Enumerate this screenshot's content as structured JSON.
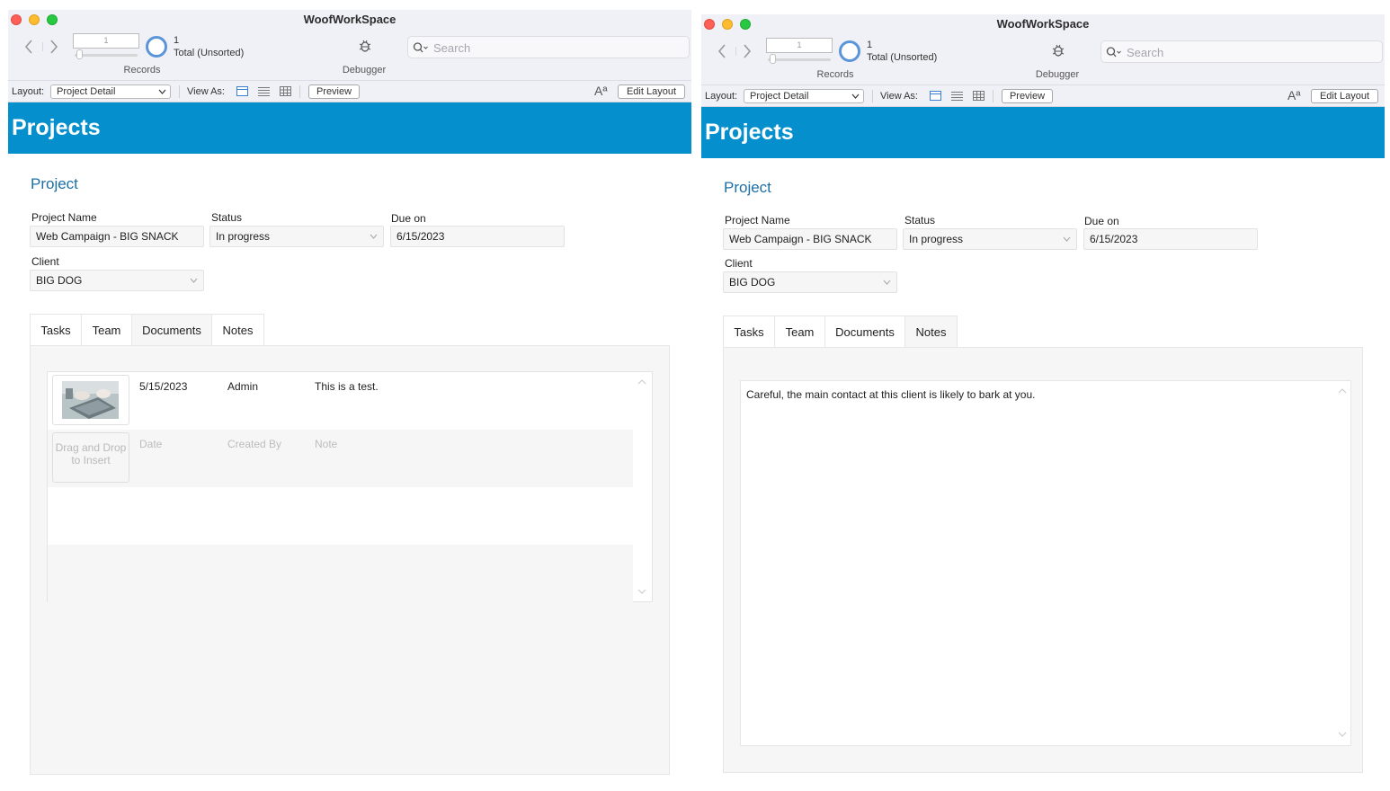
{
  "windows": [
    {
      "title": "WoofWorkSpace",
      "toolbar": {
        "record_input": "1",
        "record_count": "1",
        "record_total": "Total (Unsorted)",
        "records_label": "Records",
        "debugger_label": "Debugger",
        "search_placeholder": "Search"
      },
      "layoutbar": {
        "layout_label": "Layout:",
        "layout_value": "Project Detail",
        "view_as_label": "View As:",
        "preview_label": "Preview",
        "font_icon": "Aª",
        "edit_layout_label": "Edit Layout"
      },
      "header_title": "Projects",
      "section_title": "Project",
      "fields": {
        "project_name_label": "Project Name",
        "project_name": "Web Campaign - BIG SNACK",
        "status_label": "Status",
        "status": "In progress",
        "due_label": "Due on",
        "due": "6/15/2023",
        "client_label": "Client",
        "client": "BIG DOG"
      },
      "tabs": [
        {
          "label": "Tasks"
        },
        {
          "label": "Team"
        },
        {
          "label": "Documents",
          "active": true
        },
        {
          "label": "Notes"
        }
      ],
      "documents": {
        "row": {
          "date": "5/15/2023",
          "created_by": "Admin",
          "note": "This is a test."
        },
        "placeholder": {
          "drop": "Drag and Drop to Insert",
          "date": "Date",
          "created_by": "Created By",
          "note": "Note"
        }
      }
    },
    {
      "title": "WoofWorkSpace",
      "toolbar": {
        "record_input": "1",
        "record_count": "1",
        "record_total": "Total (Unsorted)",
        "records_label": "Records",
        "debugger_label": "Debugger",
        "search_placeholder": "Search"
      },
      "layoutbar": {
        "layout_label": "Layout:",
        "layout_value": "Project Detail",
        "view_as_label": "View As:",
        "preview_label": "Preview",
        "font_icon": "Aª",
        "edit_layout_label": "Edit Layout"
      },
      "header_title": "Projects",
      "section_title": "Project",
      "fields": {
        "project_name_label": "Project Name",
        "project_name": "Web Campaign - BIG SNACK",
        "status_label": "Status",
        "status": "In progress",
        "due_label": "Due on",
        "due": "6/15/2023",
        "client_label": "Client",
        "client": "BIG DOG"
      },
      "tabs": [
        {
          "label": "Tasks"
        },
        {
          "label": "Team"
        },
        {
          "label": "Documents"
        },
        {
          "label": "Notes",
          "active": true
        }
      ],
      "notes_text": "Careful, the main contact at this client is likely to bark at you."
    }
  ],
  "colors": {
    "header_band": "#058fcc",
    "section_title": "#1c6fa4",
    "toolbar_bg": "#f0f0f7",
    "traffic_red": "#fe5f57",
    "traffic_yellow": "#febc2e",
    "traffic_green": "#28c840"
  },
  "icons": [
    "back-arrow-icon",
    "forward-arrow-icon",
    "record-pie-icon",
    "bug-icon",
    "search-icon",
    "chevron-down-icon",
    "form-view-icon",
    "list-view-icon",
    "table-view-icon",
    "font-size-icon",
    "scroll-up-icon",
    "scroll-down-icon",
    "document-thumbnail"
  ]
}
